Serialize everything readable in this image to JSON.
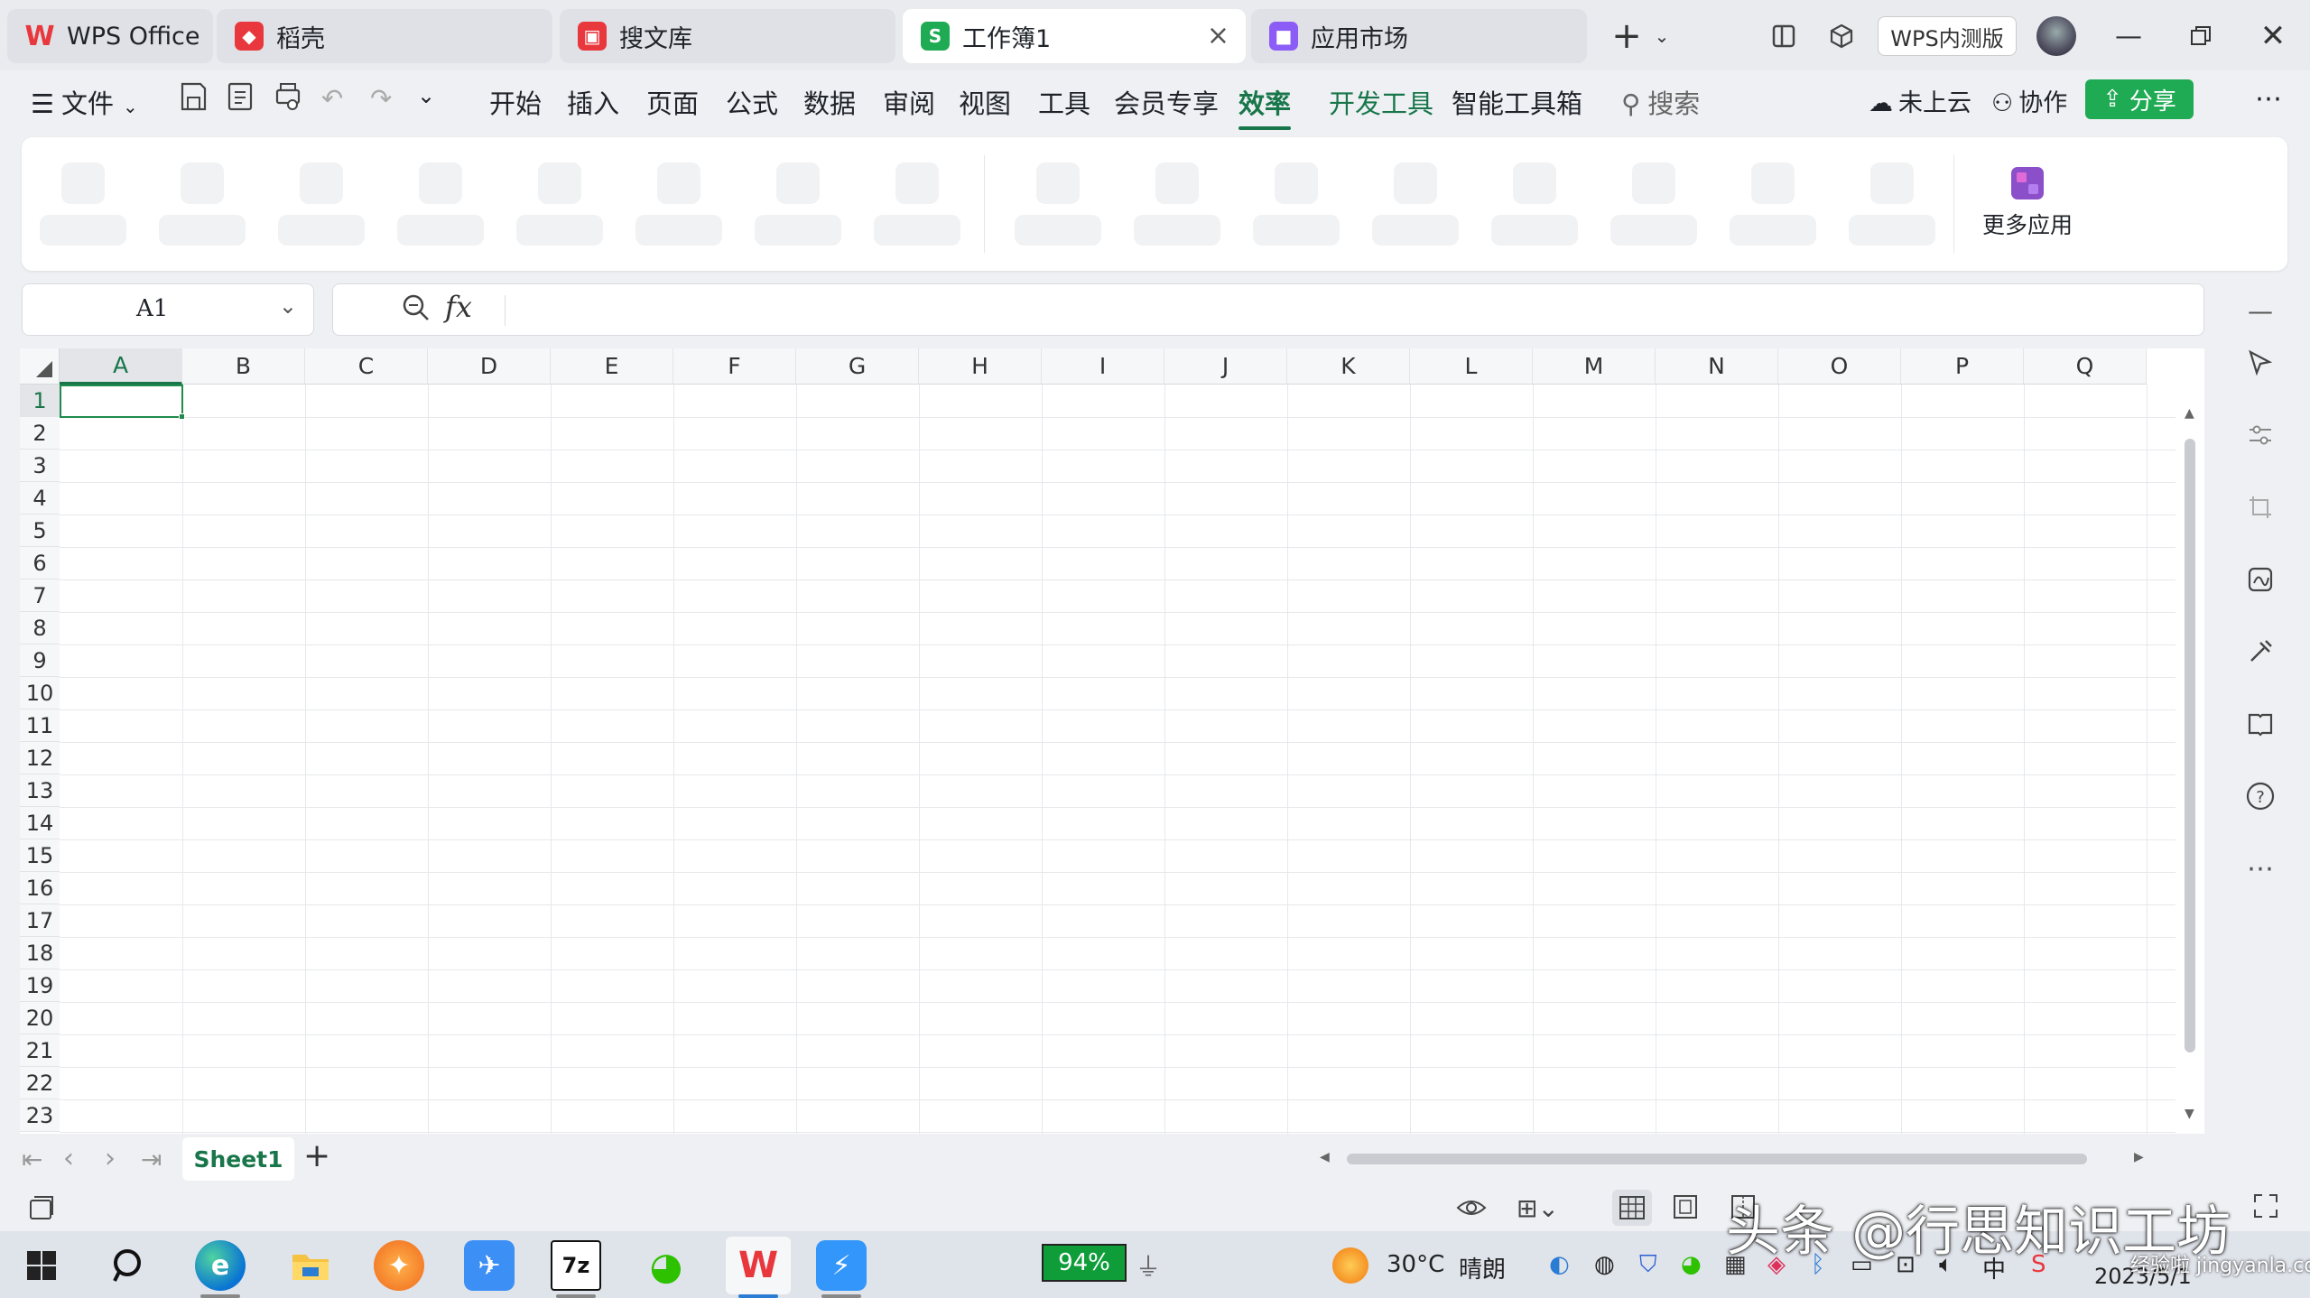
{
  "tabs": [
    {
      "label": "WPS Office",
      "icon": "wps-logo-icon",
      "color": "#e8383d"
    },
    {
      "label": "稻壳",
      "icon": "docer-icon",
      "color": "#e8383d"
    },
    {
      "label": "搜文库",
      "icon": "library-icon",
      "color": "#e8383d"
    },
    {
      "label": "工作簿1",
      "icon": "spreadsheet-icon",
      "color": "#1faa54",
      "active": true
    },
    {
      "label": "应用市场",
      "icon": "app-market-icon",
      "color": "#8b5cf6"
    }
  ],
  "titlebar": {
    "version_badge": "WPS内测版"
  },
  "menubar": {
    "file": "文件",
    "items": [
      "开始",
      "插入",
      "页面",
      "公式",
      "数据",
      "审阅",
      "视图",
      "工具",
      "会员专享",
      "效率",
      "开发工具",
      "智能工具箱"
    ],
    "selected": "效率",
    "search": "搜索",
    "cloud": "未上云",
    "collab": "协作",
    "share": "分享"
  },
  "ribbon": {
    "more_apps": "更多应用"
  },
  "formula": {
    "cell_ref": "A1",
    "fx": "fx"
  },
  "columns": [
    "A",
    "B",
    "C",
    "D",
    "E",
    "F",
    "G",
    "H",
    "I",
    "J",
    "K",
    "L",
    "M",
    "N",
    "O",
    "P",
    "Q"
  ],
  "rows": [
    "1",
    "2",
    "3",
    "4",
    "5",
    "6",
    "7",
    "8",
    "9",
    "10",
    "11",
    "12",
    "13",
    "14",
    "15",
    "16",
    "17",
    "18",
    "19",
    "20",
    "21",
    "22",
    "23"
  ],
  "sheet": {
    "name": "Sheet1",
    "add": "+"
  },
  "taskbar": {
    "battery": "94%",
    "weather_temp": "30°C",
    "weather_desc": "晴朗",
    "date": "2023/5/1"
  },
  "watermark": {
    "text": "头条 @行思知识工坊",
    "site": "经验啦 jingyanla.com"
  }
}
